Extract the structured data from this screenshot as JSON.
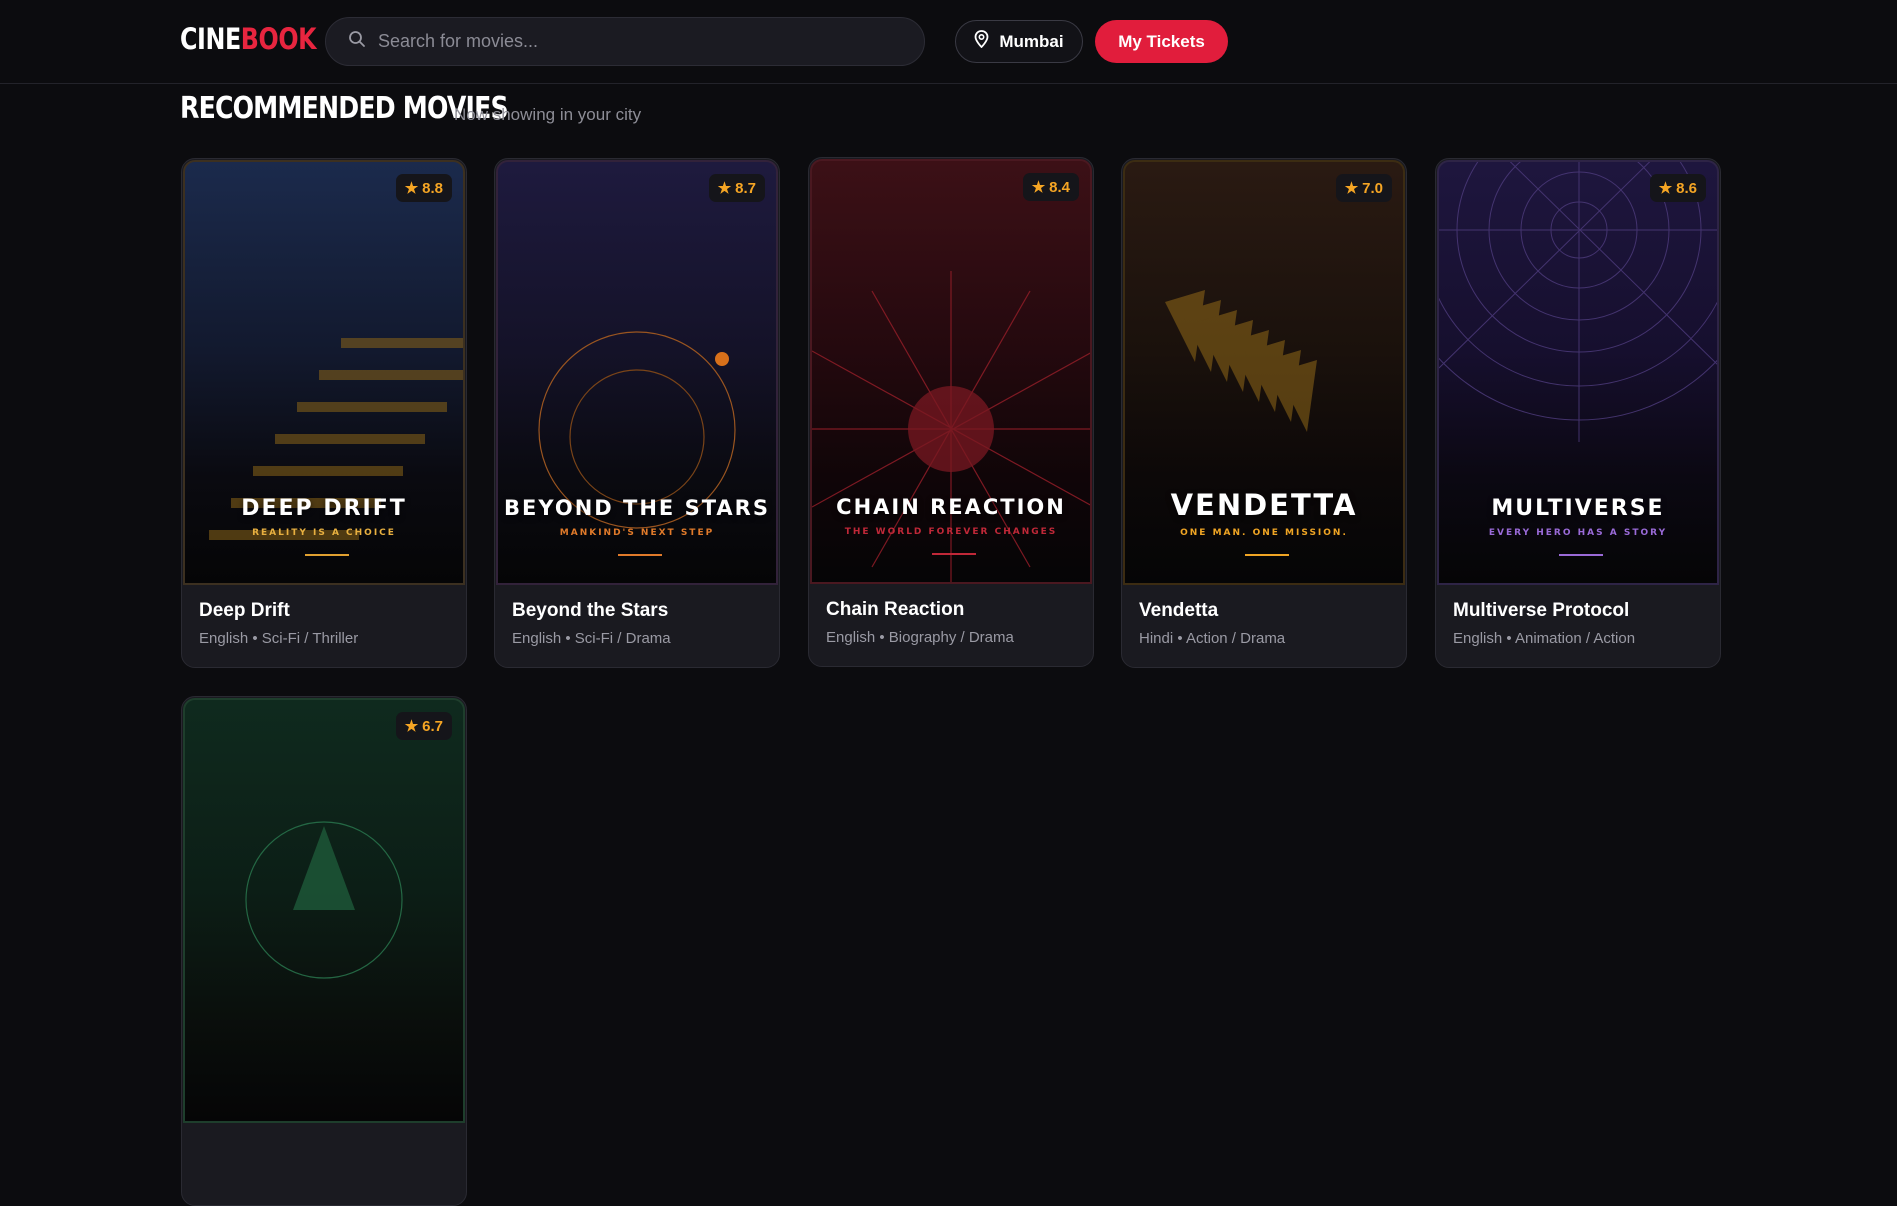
{
  "header": {
    "logo_part1": "CINE",
    "logo_part2": "BOOK",
    "search_placeholder": "Search for movies...",
    "location": "Mumbai",
    "tickets_label": "My Tickets"
  },
  "section": {
    "title": "RECOMMENDED MOVIES",
    "subtitle": "Now showing in your city"
  },
  "movies": [
    {
      "poster_title": "DEEP DRIFT",
      "tagline": "REALITY IS A CHOICE",
      "rating": "8.8",
      "name": "Deep Drift",
      "language": "English",
      "genres": "Sci-Fi / Thriller",
      "accent": "#e0a030"
    },
    {
      "poster_title": "BEYOND THE STARS",
      "tagline": "MANKIND'S NEXT STEP",
      "rating": "8.7",
      "name": "Beyond the Stars",
      "language": "English",
      "genres": "Sci-Fi / Drama",
      "accent": "#e07a2a"
    },
    {
      "poster_title": "CHAIN REACTION",
      "tagline": "THE WORLD FOREVER CHANGES",
      "rating": "8.4",
      "name": "Chain Reaction",
      "language": "English",
      "genres": "Biography / Drama",
      "accent": "#c02838"
    },
    {
      "poster_title": "VENDETTA",
      "tagline": "ONE MAN. ONE MISSION.",
      "rating": "7.0",
      "name": "Vendetta",
      "language": "Hindi",
      "genres": "Action / Drama",
      "accent": "#f0a524"
    },
    {
      "poster_title": "MULTIVERSE",
      "tagline": "EVERY HERO HAS A STORY",
      "rating": "8.6",
      "name": "Multiverse Protocol",
      "language": "English",
      "genres": "Animation / Action",
      "accent": "#9a6ad8"
    },
    {
      "poster_title": "",
      "tagline": "",
      "rating": "6.7",
      "name": "",
      "language": "",
      "genres": "",
      "accent": "#2a8a5a"
    }
  ],
  "icons": {
    "search": "search-icon",
    "location": "map-pin-icon",
    "rating": "star-icon"
  },
  "colors": {
    "brand": "#e11d3c",
    "rating": "#f5a524",
    "background": "#0c0c0f",
    "card": "#1a1a20"
  }
}
